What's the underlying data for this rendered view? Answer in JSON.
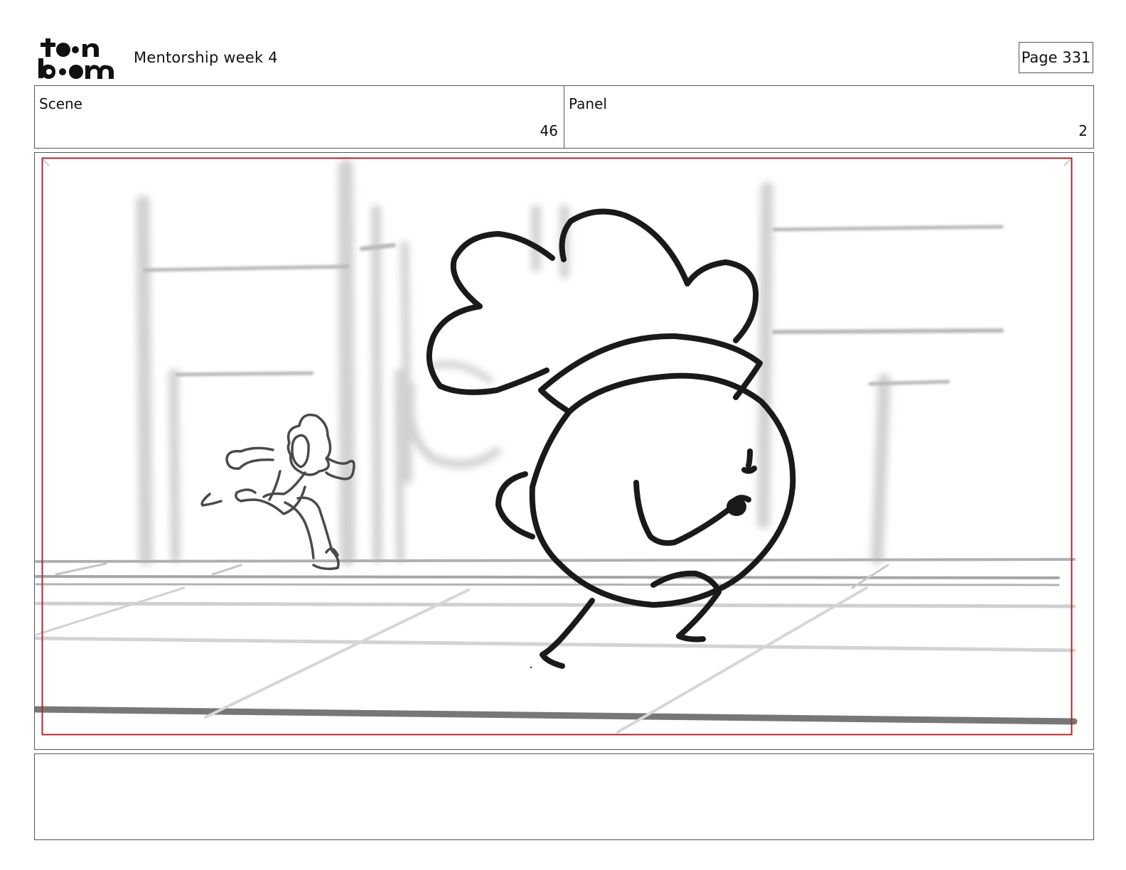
{
  "header": {
    "logo_text": "toon boom",
    "title": "Mentorship week 4",
    "page_label": "Page 331"
  },
  "info": {
    "scene_label": "Scene",
    "scene_value": "46",
    "panel_label": "Panel",
    "panel_value": "2"
  },
  "panel": {
    "safe_frame_color": "#b3262d",
    "sketch_color": "#1a1a1a",
    "background_color": "#cfcfcf"
  },
  "notes": {
    "text": ""
  }
}
